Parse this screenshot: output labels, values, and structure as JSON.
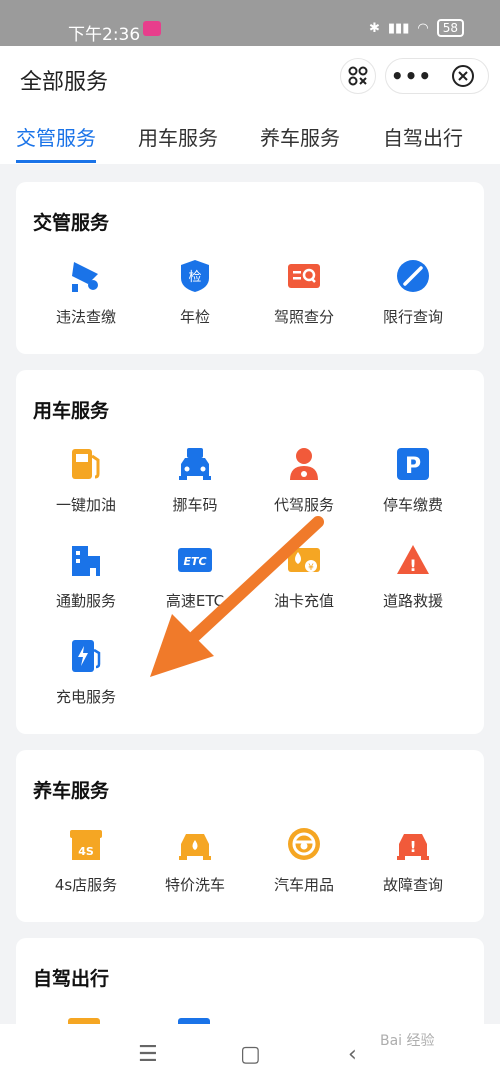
{
  "statusbar": {
    "time": "下午2:36",
    "battery": "58"
  },
  "header": {
    "title": "全部服务"
  },
  "tabs": [
    {
      "label": "交管服务"
    },
    {
      "label": "用车服务"
    },
    {
      "label": "养车服务"
    },
    {
      "label": "自驾出行"
    }
  ],
  "sections": {
    "traffic": {
      "title": "交管服务",
      "items": [
        {
          "label": "违法查缴",
          "icon": "camera-icon"
        },
        {
          "label": "年检",
          "icon": "inspection-shield-icon",
          "glyph": "检"
        },
        {
          "label": "驾照查分",
          "icon": "license-search-icon"
        },
        {
          "label": "限行查询",
          "icon": "no-entry-icon"
        }
      ]
    },
    "car": {
      "title": "用车服务",
      "items": [
        {
          "label": "一键加油",
          "icon": "fuel-pump-icon"
        },
        {
          "label": "挪车码",
          "icon": "car-qr-icon"
        },
        {
          "label": "代驾服务",
          "icon": "driver-icon"
        },
        {
          "label": "停车缴费",
          "icon": "parking-icon",
          "glyph": "P"
        },
        {
          "label": "通勤服务",
          "icon": "building-icon"
        },
        {
          "label": "高速ETC",
          "icon": "etc-icon",
          "glyph": "ETC"
        },
        {
          "label": "油卡充值",
          "icon": "fuel-card-icon",
          "glyph": "¥"
        },
        {
          "label": "道路救援",
          "icon": "warning-icon",
          "glyph": "!"
        },
        {
          "label": "充电服务",
          "icon": "charging-icon"
        }
      ]
    },
    "maintain": {
      "title": "养车服务",
      "items": [
        {
          "label": "4s店服务",
          "icon": "store-4s-icon",
          "glyph": "4S"
        },
        {
          "label": "特价洗车",
          "icon": "car-wash-icon"
        },
        {
          "label": "汽车用品",
          "icon": "steering-wheel-icon"
        },
        {
          "label": "故障查询",
          "icon": "car-fault-icon",
          "glyph": "!"
        }
      ]
    },
    "trip": {
      "title": "自驾出行"
    }
  },
  "colors": {
    "accent": "#1a73e8",
    "orange": "#f5a623",
    "red": "#f15a3a",
    "arrow": "#f07a2a"
  },
  "watermark": "Bai 经验"
}
